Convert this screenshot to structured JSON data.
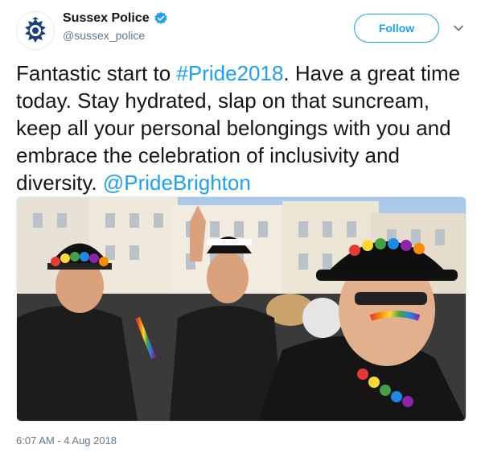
{
  "account": {
    "display_name": "Sussex Police",
    "handle": "@sussex_police",
    "verified": true,
    "avatar_icon": "police-crest-icon"
  },
  "follow_button": {
    "label": "Follow"
  },
  "menu": {
    "icon": "chevron-down-icon"
  },
  "tweet": {
    "text_before": "Fantastic start to ",
    "hashtag": "#Pride2018",
    "text_after": ". Have a great time today. Stay hydrated, slap on that suncream, keep all your personal belongings with you and embrace the celebration of inclusivity and diversity.  ",
    "mention": "@PrideBrighton",
    "media_description_icon": "photo-image",
    "timestamp": "6:07 AM - 4 Aug 2018"
  },
  "colors": {
    "link": "#1da1f2",
    "text": "#14171a",
    "secondary": "#657786",
    "verified": "#1da1f2"
  }
}
